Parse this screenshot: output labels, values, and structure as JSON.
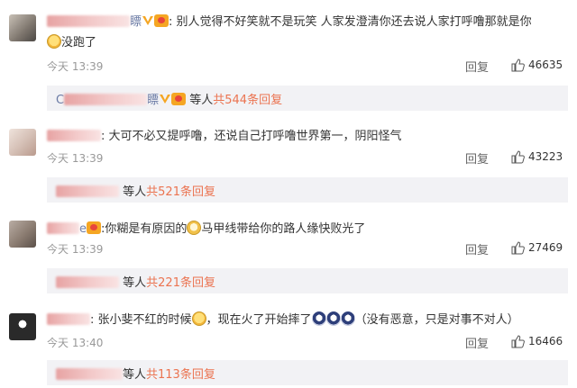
{
  "comments": [
    {
      "name_tail": "瞟",
      "text": "别人觉得不好笑就不是玩笑 人家发澄清你还去说人家打呼噜那就是你",
      "text2": "没跑了",
      "time": "今天 13:39",
      "reply_label": "回复",
      "likes": "46635",
      "sub_name_prefix": "C",
      "sub_name_tail": "瞟",
      "sub_prefix": "等人",
      "sub_link": "共544条回复"
    },
    {
      "name_tail": "",
      "text": "大可不必又提呼噜，还说自己打呼噜世界第一，阴阳怪气",
      "time": "今天 13:39",
      "reply_label": "回复",
      "likes": "43223",
      "sub_prefix": "等人",
      "sub_link": "共521条回复"
    },
    {
      "name_tail": "e",
      "text": "你糊是有原因的",
      "text_after": "马甲线带给你的路人缘快败光了",
      "time": "今天 13:39",
      "reply_label": "回复",
      "likes": "27469",
      "sub_prefix": "等人",
      "sub_link": "共221条回复"
    },
    {
      "name_tail": "",
      "text": "张小斐不红的时候",
      "text_after": "，现在火了开始摔了",
      "text_end": "（没有恶意，只是对事不对人）",
      "time": "今天 13:40",
      "reply_label": "回复",
      "likes": "16466",
      "sub_prefix": "等人",
      "sub_link": "共113条回复"
    }
  ],
  "colors": {
    "link": "#eb7350",
    "name": "#6b7ba5",
    "meta": "#999999",
    "sub_bg": "#f2f2f5"
  },
  "icons": [
    "thumbs-up-icon",
    "vip-v-icon",
    "level-badge-icon",
    "emoji-icon"
  ]
}
